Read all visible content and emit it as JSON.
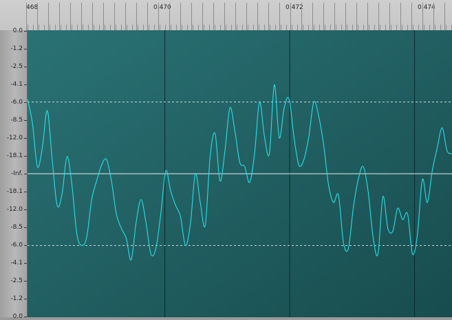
{
  "ruler": {
    "labels": [
      "468",
      "0.470",
      "0.472",
      "0.474"
    ]
  },
  "db_scale": {
    "labels": [
      "0.0",
      "-1.2",
      "-2.5",
      "-4.1",
      "-6.0",
      "-8.5",
      "-12.0",
      "-18.1",
      "-Inf.",
      "-18.1",
      "-12.0",
      "-8.5",
      "-6.0",
      "-4.1",
      "-2.5",
      "-1.2",
      "0.0"
    ]
  },
  "colors": {
    "background": "#1f5f60",
    "waveform": "#29e0e8",
    "center_line": "#e6f0f0",
    "dashed_line": "#e6f0f0",
    "grid_line": "#0a2a2a"
  },
  "chart_data": {
    "type": "line",
    "x_range": [
      0.4678,
      0.4746
    ],
    "y_range": [
      -1,
      1
    ],
    "grid_x": [
      0.47,
      0.472,
      0.474
    ],
    "dashed_y": [
      0.5,
      -0.5
    ],
    "x_start": 0.4678,
    "x_end": 0.4746,
    "y": [
      0.52,
      0.35,
      0.05,
      0.18,
      0.44,
      0.1,
      -0.22,
      -0.14,
      0.12,
      -0.08,
      -0.42,
      -0.5,
      -0.44,
      -0.18,
      -0.05,
      0.06,
      0.1,
      -0.05,
      -0.28,
      -0.38,
      -0.45,
      -0.6,
      -0.34,
      -0.18,
      -0.34,
      -0.56,
      -0.52,
      -0.28,
      0.02,
      -0.12,
      -0.22,
      -0.3,
      -0.5,
      -0.35,
      0.0,
      -0.2,
      -0.36,
      0.12,
      0.28,
      -0.05,
      0.16,
      0.46,
      0.3,
      0.08,
      0.05,
      -0.06,
      0.14,
      0.5,
      0.26,
      0.14,
      0.62,
      0.25,
      0.46,
      0.52,
      0.25,
      0.06,
      0.1,
      0.26,
      0.5,
      0.4,
      0.2,
      -0.08,
      -0.2,
      -0.15,
      -0.48,
      -0.52,
      -0.24,
      -0.04,
      0.05,
      -0.12,
      -0.44,
      -0.56,
      -0.16,
      -0.38,
      -0.4,
      -0.24,
      -0.32,
      -0.28,
      -0.56,
      -0.42,
      -0.04,
      -0.2,
      0.02,
      0.18,
      0.32,
      0.16,
      0.14
    ]
  }
}
